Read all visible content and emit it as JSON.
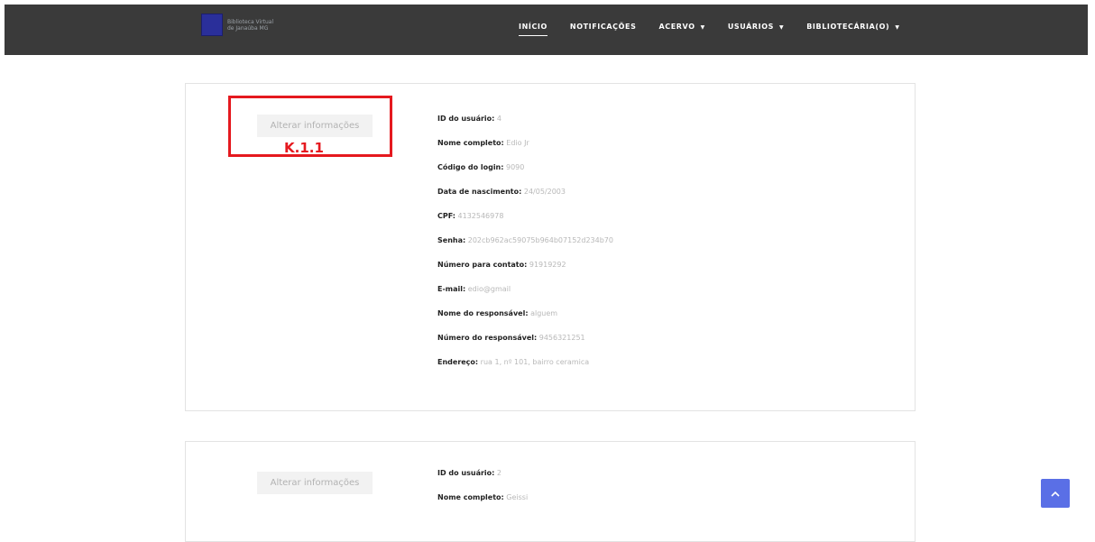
{
  "brand": {
    "line1": "Biblioteca Virtual",
    "line2": "de Janaúba MG"
  },
  "nav": {
    "inicio": "INÍCIO",
    "notificacoes": "NOTIFICAÇÕES",
    "acervo": "ACERVO",
    "usuarios": "USUÁRIOS",
    "bibliotecaria": "BIBLIOTECÁRIA(O)",
    "caret": "▼"
  },
  "annotation": "K.1.1",
  "edit_label": "Alterar informações",
  "users": [
    {
      "id_label": "ID do usuário:",
      "id": "4",
      "nome_label": "Nome completo:",
      "nome": "Edio Jr",
      "codigo_label": "Código do login:",
      "codigo": "9090",
      "nasc_label": "Data de nascimento:",
      "nasc": "24/05/2003",
      "cpf_label": "CPF:",
      "cpf": "4132546978",
      "senha_label": "Senha:",
      "senha": "202cb962ac59075b964b07152d234b70",
      "contato_label": "Número para contato:",
      "contato": "91919292",
      "email_label": "E-mail:",
      "email": "edio@gmail",
      "resp_label": "Nome do responsável:",
      "resp": "alguem",
      "resp_num_label": "Número do responsável:",
      "resp_num": "9456321251",
      "endereco_label": "Endereço:",
      "endereco": "rua 1, nº 101, bairro ceramica"
    },
    {
      "id_label": "ID do usuário:",
      "id": "2",
      "nome_label": "Nome completo:",
      "nome": "Geissi"
    }
  ],
  "scroll_top_icon": "chevron-up"
}
